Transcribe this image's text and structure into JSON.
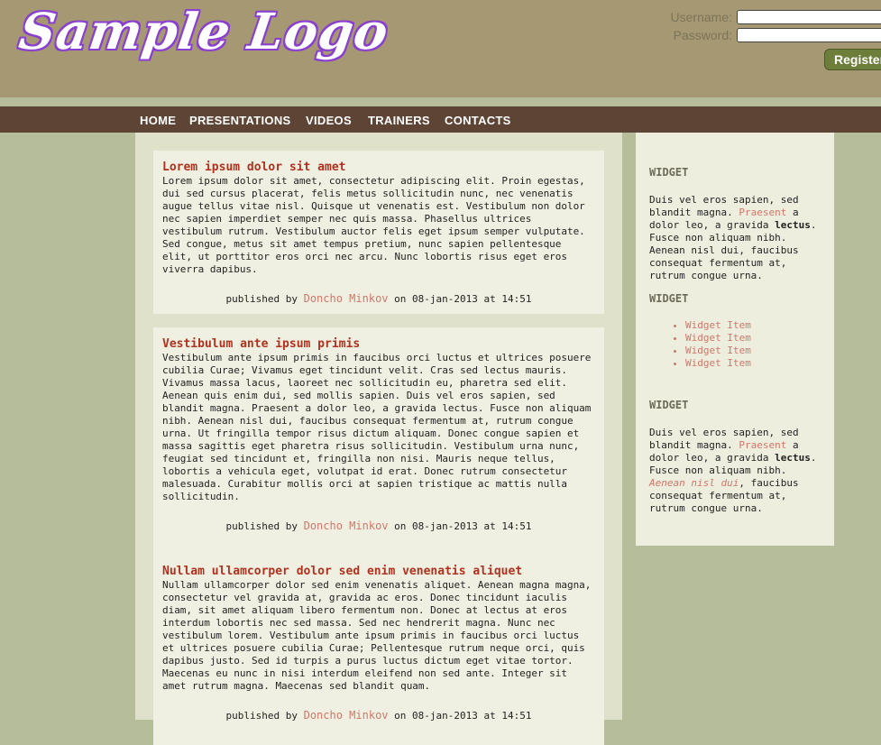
{
  "header": {
    "logo_text": "Sample Logo",
    "username_label": "Username:",
    "password_label": "Password:",
    "register_label": "Register"
  },
  "nav": {
    "items": [
      "HOME",
      "PRESENTATIONS",
      "VIDEOS",
      "TRAINERS",
      "CONTACTS"
    ]
  },
  "posts": [
    {
      "title": "Lorem ipsum dolor sit amet",
      "body": "Lorem ipsum dolor sit amet, consectetur adipiscing elit. Proin egestas, dui sed cursus placerat, felis metus sollicitudin nunc, nec venenatis augue tellus vitae nisl. Quisque ut venenatis est. Vestibulum non dolor nec sapien imperdiet semper nec quis massa. Phasellus ultrices vestibulum rutrum. Vestibulum auctor felis eget ipsum semper vulputate. Sed congue, metus sit amet tempus pretium, nunc sapien pellentesque elit, ut porttitor eros orci nec arcu. Nunc lobortis risus eget eros viverra dapibus.",
      "published_by": "published by",
      "author": "Doncho Minkov",
      "date_text": "on 08-jan-2013 at 14:51"
    },
    {
      "title": "Vestibulum ante ipsum primis",
      "body": "Vestibulum ante ipsum primis in faucibus orci luctus et ultrices posuere cubilia Curae; Vivamus eget tincidunt velit. Cras sed lectus mauris. Vivamus massa lacus, laoreet nec sollicitudin eu, pharetra sed elit. Aenean quis enim dui, sed mollis sapien. Duis vel eros sapien, sed blandit magna. Praesent a dolor leo, a gravida lectus. Fusce non aliquam nibh. Aenean nisl dui, faucibus consequat fermentum at, rutrum congue urna. Ut fringilla tempor risus dictum aliquam. Donec congue sapien et massa sagittis eget pharetra risus sollicitudin. Vestibulum urna nunc, feugiat sed tincidunt et, fringilla non nisi. Mauris neque tellus, lobortis a vehicula eget, volutpat id erat. Donec rutrum consectetur malesuada. Curabitur mollis orci at sapien tristique ac mattis nulla sollicitudin.",
      "published_by": "published by",
      "author": "Doncho Minkov",
      "date_text": "on 08-jan-2013 at 14:51"
    },
    {
      "title": "Nullam ullamcorper dolor sed enim venenatis aliquet",
      "body": "Nullam ullamcorper dolor sed enim venenatis aliquet. Aenean magna magna, consectetur vel gravida at, gravida ac eros. Donec tincidunt iaculis diam, sit amet aliquam libero fermentum non. Donec at lectus at eros interdum lobortis nec sed massa. Sed nec hendrerit magna. Nunc nec vestibulum lorem. Vestibulum ante ipsum primis in faucibus orci luctus et ultrices posuere cubilia Curae; Pellentesque rutrum neque orci, quis dapibus justo. Sed id turpis a purus luctus dictum eget vitae tortor. Maecenas eu nunc in nisi interdum eleifend non sed ante. Integer sit amet rutrum magna. Maecenas sed blandit quam.",
      "published_by": "published by",
      "author": "Doncho Minkov",
      "date_text": "on 08-jan-2013 at 14:51"
    }
  ],
  "sidebar": {
    "widget_title": "WIDGET",
    "w1": {
      "t1": "Duis vel eros sapien, sed blandit magna.",
      "link": "Praesent",
      "t2": "a dolor leo, a gravida",
      "bold": "lectus",
      "t3": ". Fusce non aliquam nibh. Aenean nisl dui, faucibus consequat fermentum at, rutrum congue urna."
    },
    "w2_items": [
      "Widget Item",
      "Widget Item",
      "Widget Item",
      "Widget Item"
    ],
    "w3": {
      "t1": "Duis vel eros sapien, sed blandit magna.",
      "link": "Praesent",
      "t2": "a dolor leo, a gravida",
      "bold": "lectus",
      "t3": ". Fusce non aliquam nibh.",
      "italic_link": "Aenean nisl dui",
      "t4": ", faucibus consequat fermentum at, rutrum congue urna."
    }
  },
  "colors": {
    "header_bg": "#a69873",
    "page_bg": "#b5bd9a",
    "nav_bg": "#5e4435",
    "post_title": "#b0321e",
    "link": "#d0776a",
    "register_bg": "#6d7d3a",
    "logo_outline": "#8a3fd0"
  }
}
